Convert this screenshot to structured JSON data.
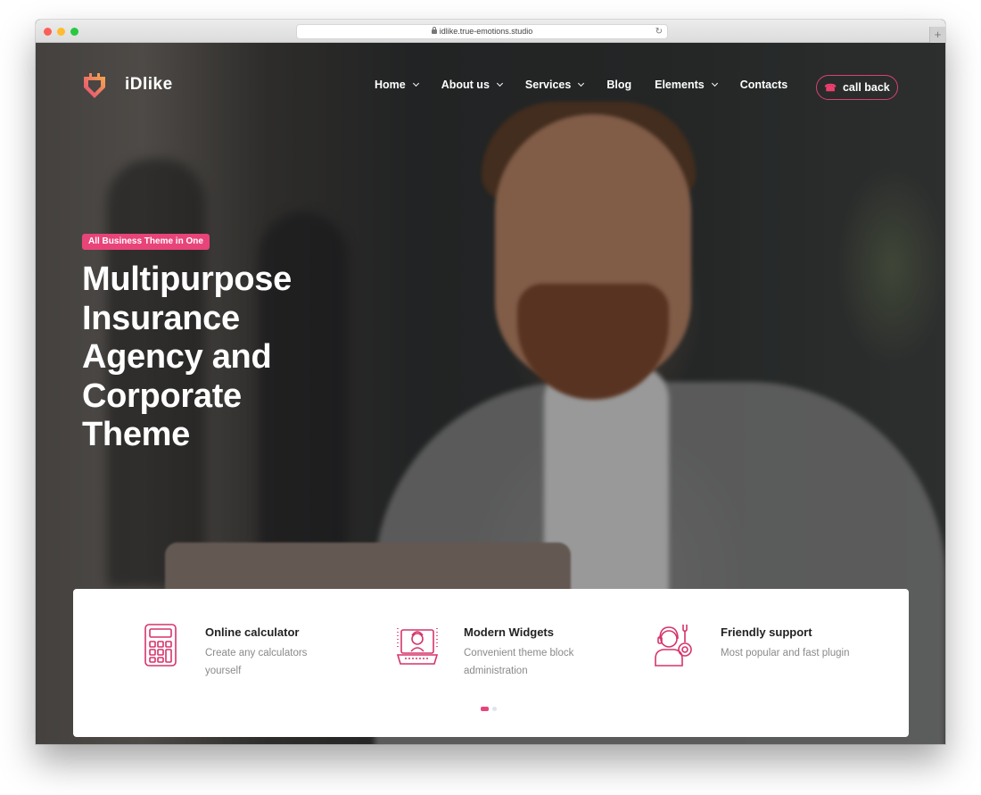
{
  "browser": {
    "url": "idlike.true-emotions.studio",
    "new_tab_label": "+"
  },
  "brand": {
    "name": "iDlike",
    "accent": "#e8447a"
  },
  "nav": {
    "items": [
      {
        "label": "Home",
        "dropdown": true
      },
      {
        "label": "About us",
        "dropdown": true
      },
      {
        "label": "Services",
        "dropdown": true
      },
      {
        "label": "Blog",
        "dropdown": false
      },
      {
        "label": "Elements",
        "dropdown": true
      },
      {
        "label": "Contacts",
        "dropdown": false
      }
    ],
    "cta": {
      "label": "call back",
      "icon": "phone-icon"
    }
  },
  "hero": {
    "badge": "All Business Theme in One",
    "headline": [
      "Multipurpose",
      "Insurance",
      "Agency and",
      "Corporate",
      "Theme"
    ]
  },
  "features": [
    {
      "icon": "calculator-icon",
      "title": "Online calculator",
      "description": "Create any calculators yourself"
    },
    {
      "icon": "laptop-widget-icon",
      "title": "Modern Widgets",
      "description": "Convenient theme block administration"
    },
    {
      "icon": "support-agent-icon",
      "title": "Friendly support",
      "description": "Most popular and fast plugin"
    }
  ],
  "carousel": {
    "pages": 2,
    "active": 1
  }
}
